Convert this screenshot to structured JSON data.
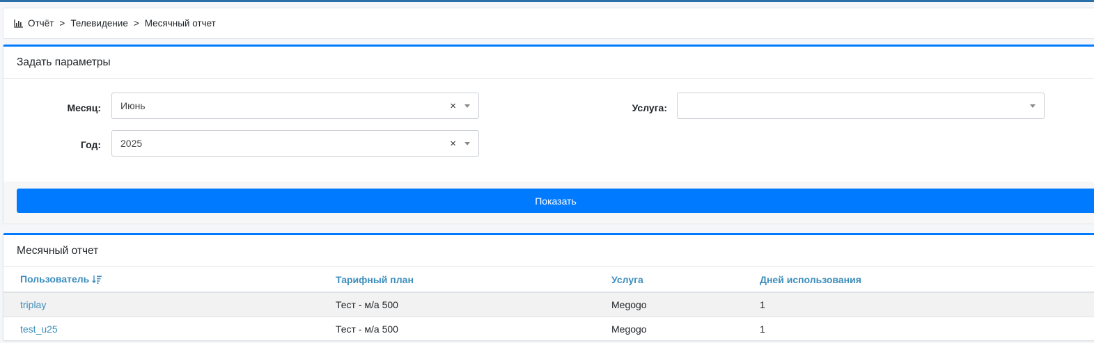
{
  "breadcrumb": {
    "items": [
      "Отчёт",
      "Телевидение",
      "Месячный отчет"
    ],
    "separator": ">"
  },
  "params": {
    "title": "Задать параметры",
    "month": {
      "label": "Месяц:",
      "value": "Июнь",
      "clear": "×"
    },
    "year": {
      "label": "Год:",
      "value": "2025",
      "clear": "×"
    },
    "service": {
      "label": "Услуга:",
      "value": ""
    },
    "show_button": "Показать"
  },
  "report": {
    "title": "Месячный отчет",
    "columns": [
      "Пользователь",
      "Тарифный план",
      "Услуга",
      "Дней использования"
    ],
    "rows": [
      [
        "triplay",
        "Тест - м/а 500",
        "Megogo",
        "1"
      ],
      [
        "test_u25",
        "Тест - м/а 500",
        "Megogo",
        "1"
      ]
    ]
  },
  "colors": {
    "accent": "#007bff",
    "link": "#3c8dbc",
    "topline": "#2c6ea6"
  },
  "icons": [
    "bar-chart-icon",
    "sort-desc-icon",
    "clear-icon",
    "chevron-down-icon"
  ]
}
